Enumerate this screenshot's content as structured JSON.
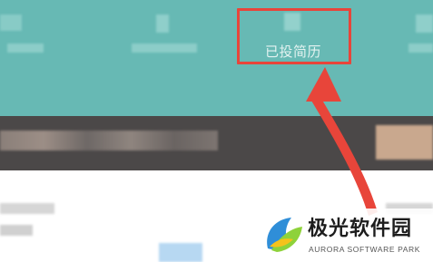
{
  "header": {
    "stats": [
      {
        "label": "已投简历",
        "highlighted": true
      }
    ]
  },
  "annotation": {
    "highlight_color": "#e8453a",
    "arrow_color": "#e8453a"
  },
  "watermark": {
    "title": "极光软件园",
    "subtitle": "AURORA SOFTWARE PARK",
    "logo_icon": "aurora-leaf-logo"
  },
  "colors": {
    "header_bg": "#67b9b4",
    "band_bg": "#4b4848"
  }
}
